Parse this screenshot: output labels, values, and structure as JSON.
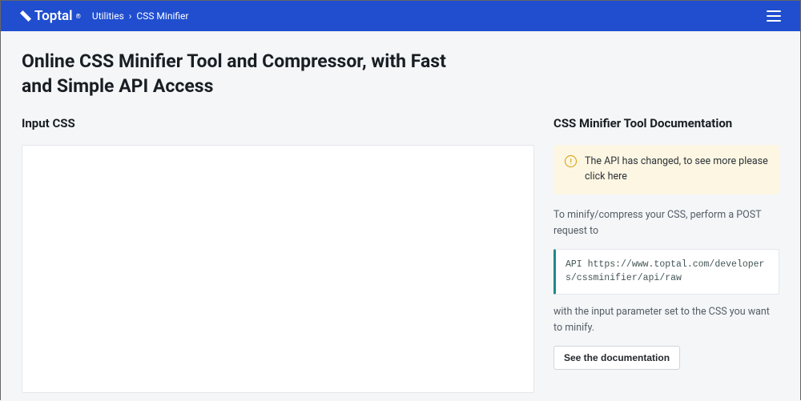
{
  "header": {
    "brand": "Toptal",
    "brand_suffix": "®",
    "crumb1": "Utilities",
    "crumb_sep": "›",
    "crumb2": "CSS Minifier"
  },
  "title": "Online CSS Minifier Tool and Compressor, with Fast and Simple API Access",
  "input_heading": "Input CSS",
  "docs": {
    "heading": "CSS Minifier Tool Documentation",
    "notice_text": "The API has changed, to see more please click ",
    "notice_link": "here",
    "para1": "To minify/compress your CSS, perform a POST request to",
    "api_label": "API ",
    "api_url": "https://www.toptal.com/developers/cssminifier/api/raw",
    "para2": "with the input parameter set to the CSS you want to minify.",
    "btn": "See the documentation"
  }
}
